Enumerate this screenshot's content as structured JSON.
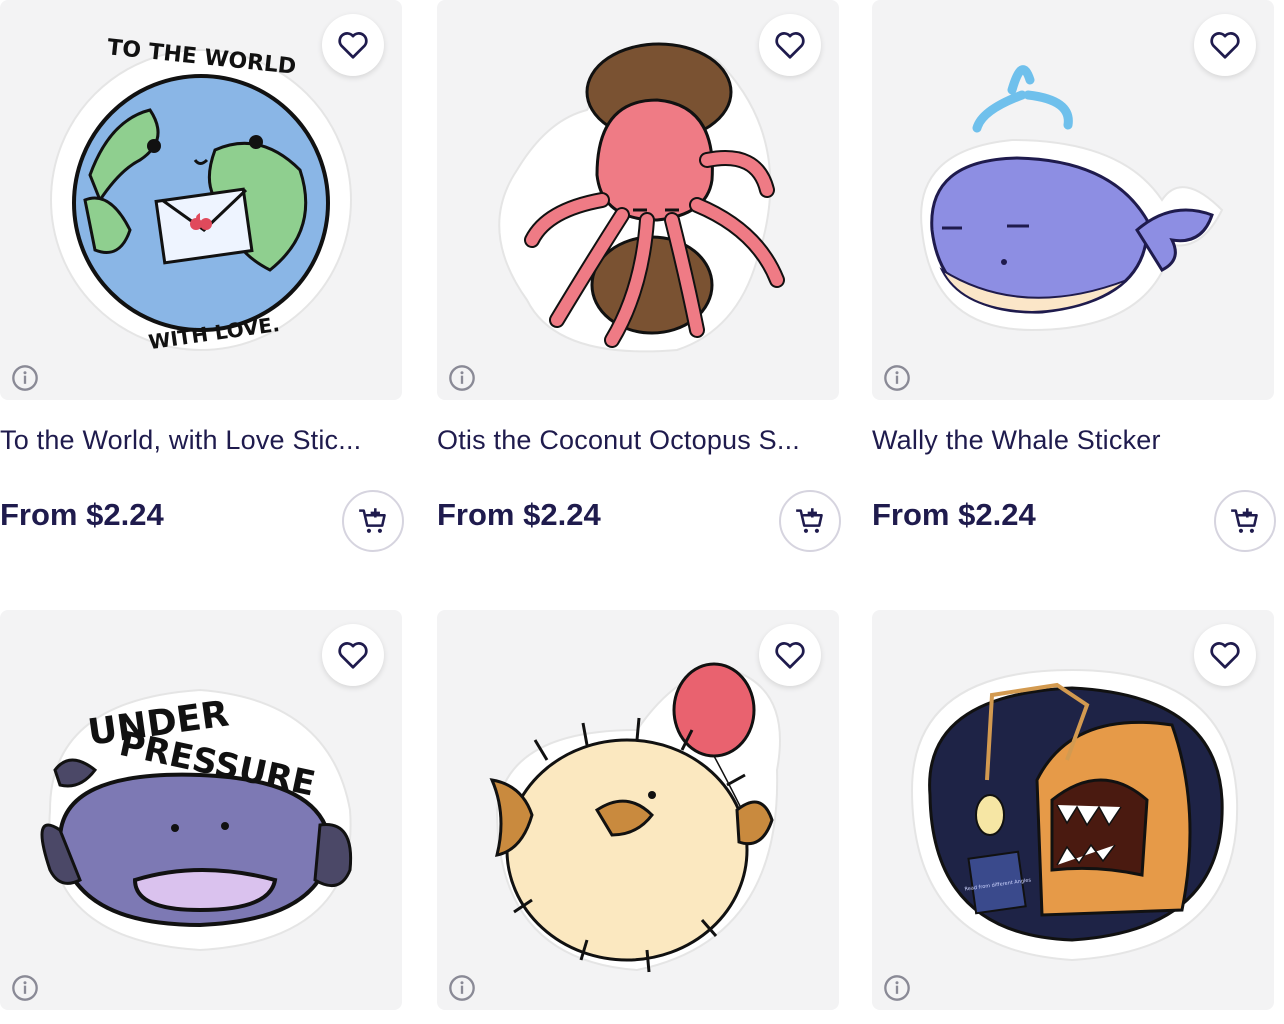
{
  "products": [
    {
      "title": "To the World, with Love Stic...",
      "price": "From $2.24",
      "sticker_text_top": "TO THE WORLD",
      "sticker_text_bottom": "WITH LOVE."
    },
    {
      "title": "Otis the Coconut Octopus S...",
      "price": "From $2.24"
    },
    {
      "title": "Wally the Whale Sticker",
      "price": "From $2.24"
    },
    {
      "title": "",
      "price": "",
      "sticker_text_top": "UNDER",
      "sticker_text_bottom": "PRESSURE"
    },
    {
      "title": "",
      "price": ""
    },
    {
      "title": "",
      "price": "",
      "book_text": "Read from different Angles"
    }
  ],
  "icons": {
    "favorite": "heart-icon",
    "add_to_cart": "cart-plus-icon",
    "info": "info-icon"
  },
  "colors": {
    "text": "#1f1b4d",
    "card_bg": "#f3f3f4",
    "border": "#d6d4df"
  }
}
